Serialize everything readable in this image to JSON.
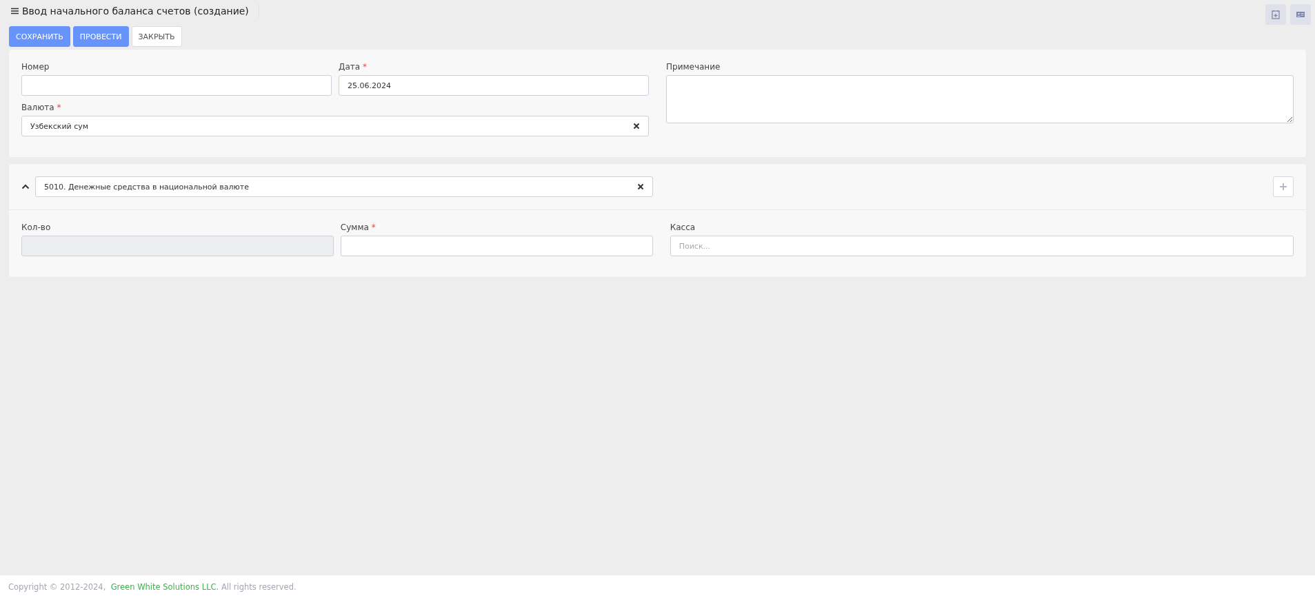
{
  "header": {
    "title": "Ввод начального баланса счетов (создание)"
  },
  "actions": [
    {
      "label": "СОХРАНИТЬ",
      "kind": "primary"
    },
    {
      "label": "ПРОВЕСТИ",
      "kind": "primary"
    },
    {
      "label": "ЗАКРЫТЬ",
      "kind": "default"
    }
  ],
  "main_form": {
    "number": {
      "label": "Номер"
    },
    "date": {
      "label": "Дата",
      "required_mark": "*",
      "value": "25.06.2024"
    },
    "currency": {
      "label": "Валюта",
      "required_mark": "*",
      "value": "Узбекский сум"
    },
    "note": {
      "label": "Примечание"
    }
  },
  "account_section": {
    "expanded": true,
    "account": "5010. Денежные средства в национальной валюте",
    "fields": [
      {
        "label": "Кол-во",
        "disabled": true
      },
      {
        "label": "Сумма",
        "required_mark": "*",
        "disabled": false
      },
      {
        "label": "Касса",
        "disabled": false,
        "placeholder": "Поиск..."
      }
    ]
  },
  "footer": {
    "copyright": "Copyright © 2012-2024,",
    "company": "Green White Solutions LLC.",
    "rights": "All rights reserved."
  }
}
